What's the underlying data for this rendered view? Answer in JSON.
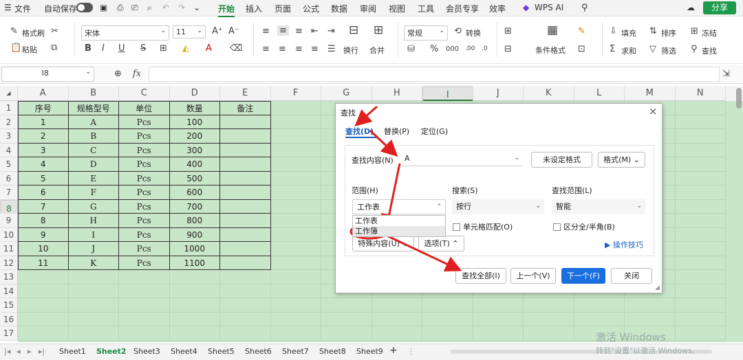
{
  "menubar": {
    "menu_icon": "☰",
    "file": "文件",
    "autosave": "自动保存",
    "tabs": [
      "开始",
      "插入",
      "页面",
      "公式",
      "数据",
      "审阅",
      "视图",
      "工具",
      "会员专享",
      "效率"
    ],
    "wps_ai": "WPS AI",
    "share": "分享"
  },
  "ribbon": {
    "format_painter": "格式刷",
    "paste": "粘贴",
    "font_name": "宋体",
    "font_size": "11",
    "wrap": "换行",
    "merge": "合并",
    "number_format": "常规",
    "convert": "转换",
    "conditional_format": "条件格式",
    "fill": "填充",
    "sort": "排序",
    "freeze": "冻结",
    "sum": "求和",
    "filter": "筛选",
    "find": "查找"
  },
  "formula_bar": {
    "name_box": "I8",
    "fx": "fx",
    "value": ""
  },
  "grid": {
    "columns": [
      "A",
      "B",
      "C",
      "D",
      "E",
      "F",
      "G",
      "H",
      "I",
      "J",
      "K",
      "L",
      "M",
      "N"
    ],
    "selected_column": "I",
    "selected_row": "8",
    "rows": [
      "1",
      "2",
      "3",
      "4",
      "5",
      "6",
      "7",
      "8",
      "9",
      "10",
      "11",
      "12",
      "13",
      "14",
      "15",
      "16",
      "17"
    ],
    "headers": [
      "序号",
      "规格型号",
      "单位",
      "数量",
      "备注"
    ],
    "data": [
      [
        "1",
        "A",
        "Pcs",
        "100",
        ""
      ],
      [
        "2",
        "B",
        "Pcs",
        "200",
        ""
      ],
      [
        "3",
        "C",
        "Pcs",
        "300",
        ""
      ],
      [
        "4",
        "D",
        "Pcs",
        "400",
        ""
      ],
      [
        "5",
        "E",
        "Pcs",
        "500",
        ""
      ],
      [
        "6",
        "F",
        "Pcs",
        "600",
        ""
      ],
      [
        "7",
        "G",
        "Pcs",
        "700",
        ""
      ],
      [
        "8",
        "H",
        "Pcs",
        "800",
        ""
      ],
      [
        "9",
        "I",
        "Pcs",
        "900",
        ""
      ],
      [
        "10",
        "J",
        "Pcs",
        "1000",
        ""
      ],
      [
        "11",
        "K",
        "Pcs",
        "1100",
        ""
      ]
    ]
  },
  "sheets": [
    "Sheet1",
    "Sheet2",
    "Sheet3",
    "Sheet4",
    "Sheet5",
    "Sheet6",
    "Sheet7",
    "Sheet8",
    "Sheet9"
  ],
  "active_sheet": "Sheet2",
  "dialog": {
    "title": "查找",
    "tabs": [
      "查找(D)",
      "替换(P)",
      "定位(G)"
    ],
    "find_label": "查找内容(N)",
    "find_value": "A",
    "no_format": "未设定格式",
    "format_btn": "格式(M)",
    "scope_label": "范围(H)",
    "scope_value": "工作表",
    "scope_options": [
      "工作表",
      "工作簿"
    ],
    "search_label": "搜索(S)",
    "search_value": "按行",
    "lookin_label": "查找范围(L)",
    "lookin_value": "智能",
    "match_cell": "单元格匹配(O)",
    "match_width": "区分全/半角(B)",
    "special": "特殊内容(U)",
    "options": "选项(T)",
    "tips": "操作技巧",
    "find_all": "查找全部(I)",
    "prev": "上一个(V)",
    "next": "下一个(F)",
    "close": "关闭"
  },
  "watermark": {
    "line1": "激活 Windows",
    "line2": "转到\"设置\"以激活 Windows。"
  },
  "colors": {
    "accent": "#1e8a41",
    "sheet_bg": "#c8e6c8",
    "primary_btn": "#1a6fe0",
    "annotation": "#e02020"
  }
}
